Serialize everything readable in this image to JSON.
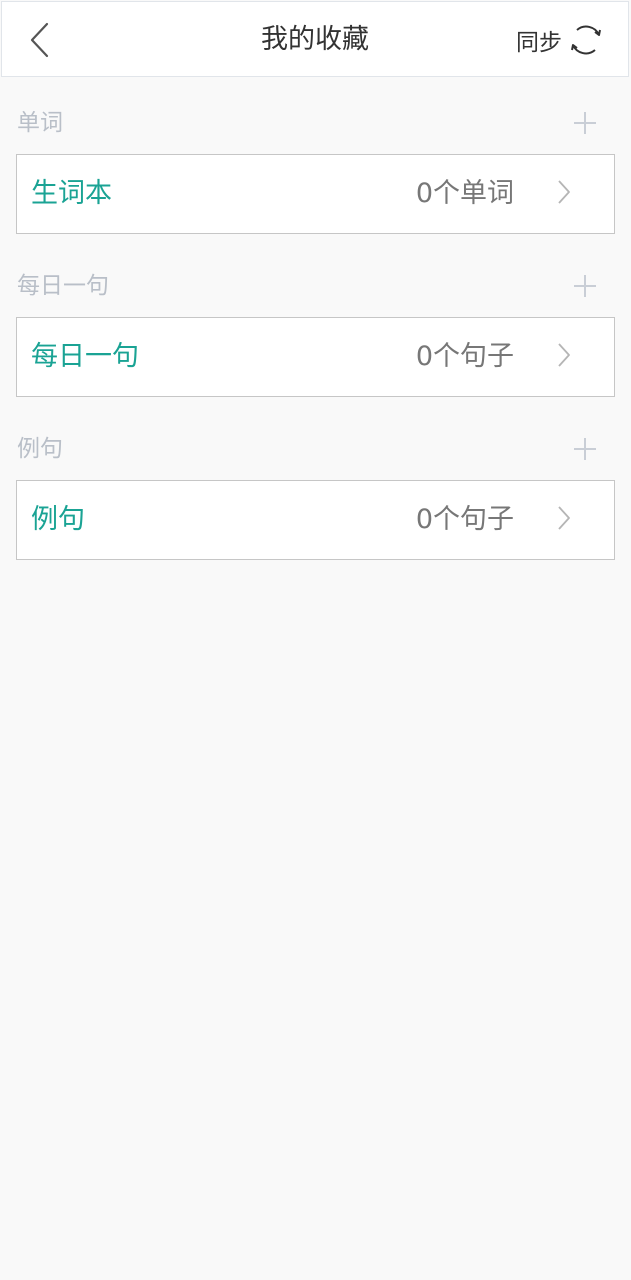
{
  "header": {
    "title": "我的收藏",
    "sync_label": "同步"
  },
  "sections": [
    {
      "title": "单词",
      "item": {
        "name": "生词本",
        "count": "0个单词"
      }
    },
    {
      "title": "每日一句",
      "item": {
        "name": "每日一句",
        "count": "0个句子"
      }
    },
    {
      "title": "例句",
      "item": {
        "name": "例句",
        "count": "0个句子"
      }
    }
  ],
  "icons": {
    "back": "chevron-left-icon",
    "sync": "sync-icon",
    "add": "plus-icon",
    "arrow": "chevron-right-icon"
  },
  "colors": {
    "accent": "#1aa394",
    "section_title": "#b9bfc8",
    "count_text": "#777777",
    "background": "#f9f9f9"
  }
}
